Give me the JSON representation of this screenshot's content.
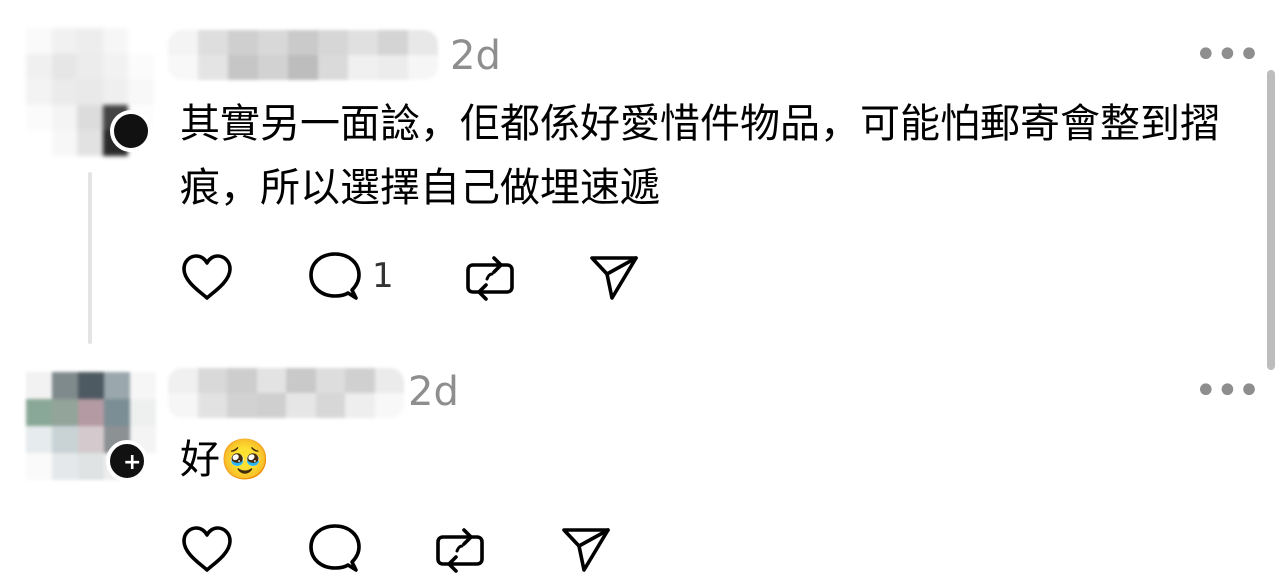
{
  "comments": [
    {
      "timestamp": "2d",
      "more_label": "•••",
      "text": "其實另一面諗，佢都係好愛惜件物品，可能怕郵寄會整到摺痕，所以選擇自己做埋速遞",
      "reply_count": "1",
      "icons": [
        "heart-icon",
        "comment-icon",
        "repost-icon",
        "share-icon"
      ]
    },
    {
      "timestamp": "2d",
      "more_label": "•••",
      "text": "好🥹",
      "reply_count": "",
      "icons": [
        "heart-icon",
        "comment-icon",
        "repost-icon",
        "share-icon"
      ]
    }
  ],
  "colors": {
    "text": "#000000",
    "muted": "#8e8e8e",
    "thread_line": "#e4e4e4",
    "badge": "#111111"
  }
}
